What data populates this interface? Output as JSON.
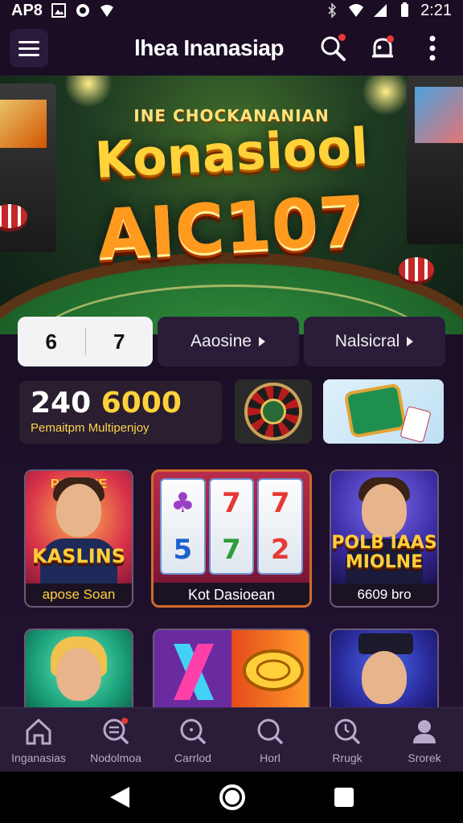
{
  "status_bar": {
    "left_text": "AP8",
    "time": "2:21"
  },
  "header": {
    "title": "lhea Inanasiap"
  },
  "hero": {
    "small_text": "INE CHOCKANANIAN",
    "headline_1": "Konasiool",
    "headline_2": "AIC107"
  },
  "tabs": {
    "segment_left": "6",
    "segment_right": "7",
    "pill_1": "Aaosine",
    "pill_2": "Nalsicral"
  },
  "promo": {
    "number_white": "240",
    "number_gold": "6000",
    "subtitle": "Pemaitpm Multipenjoy"
  },
  "games": [
    {
      "title": "KASLINS",
      "banner": "PO JAHE",
      "caption": "apose Soan"
    },
    {
      "title": "",
      "caption": "Kot Dasioean",
      "reels": [
        "♣",
        "7",
        "7",
        "5",
        "7",
        "2"
      ]
    },
    {
      "title": "POLB IAAS MIOLNE",
      "caption": "6609 bro"
    }
  ],
  "bottom_nav": [
    {
      "label": "Inganasias",
      "icon": "home-icon"
    },
    {
      "label": "Nodolmoa",
      "icon": "search-list-icon"
    },
    {
      "label": "Carrlod",
      "icon": "search-icon"
    },
    {
      "label": "Horl",
      "icon": "search-icon"
    },
    {
      "label": "Rrugk",
      "icon": "clock-search-icon"
    },
    {
      "label": "Srorek",
      "icon": "profile-icon"
    }
  ],
  "colors": {
    "background": "#1a0d24",
    "accent_gold": "#ffd23a",
    "nav_bg": "#2a1d3a"
  }
}
